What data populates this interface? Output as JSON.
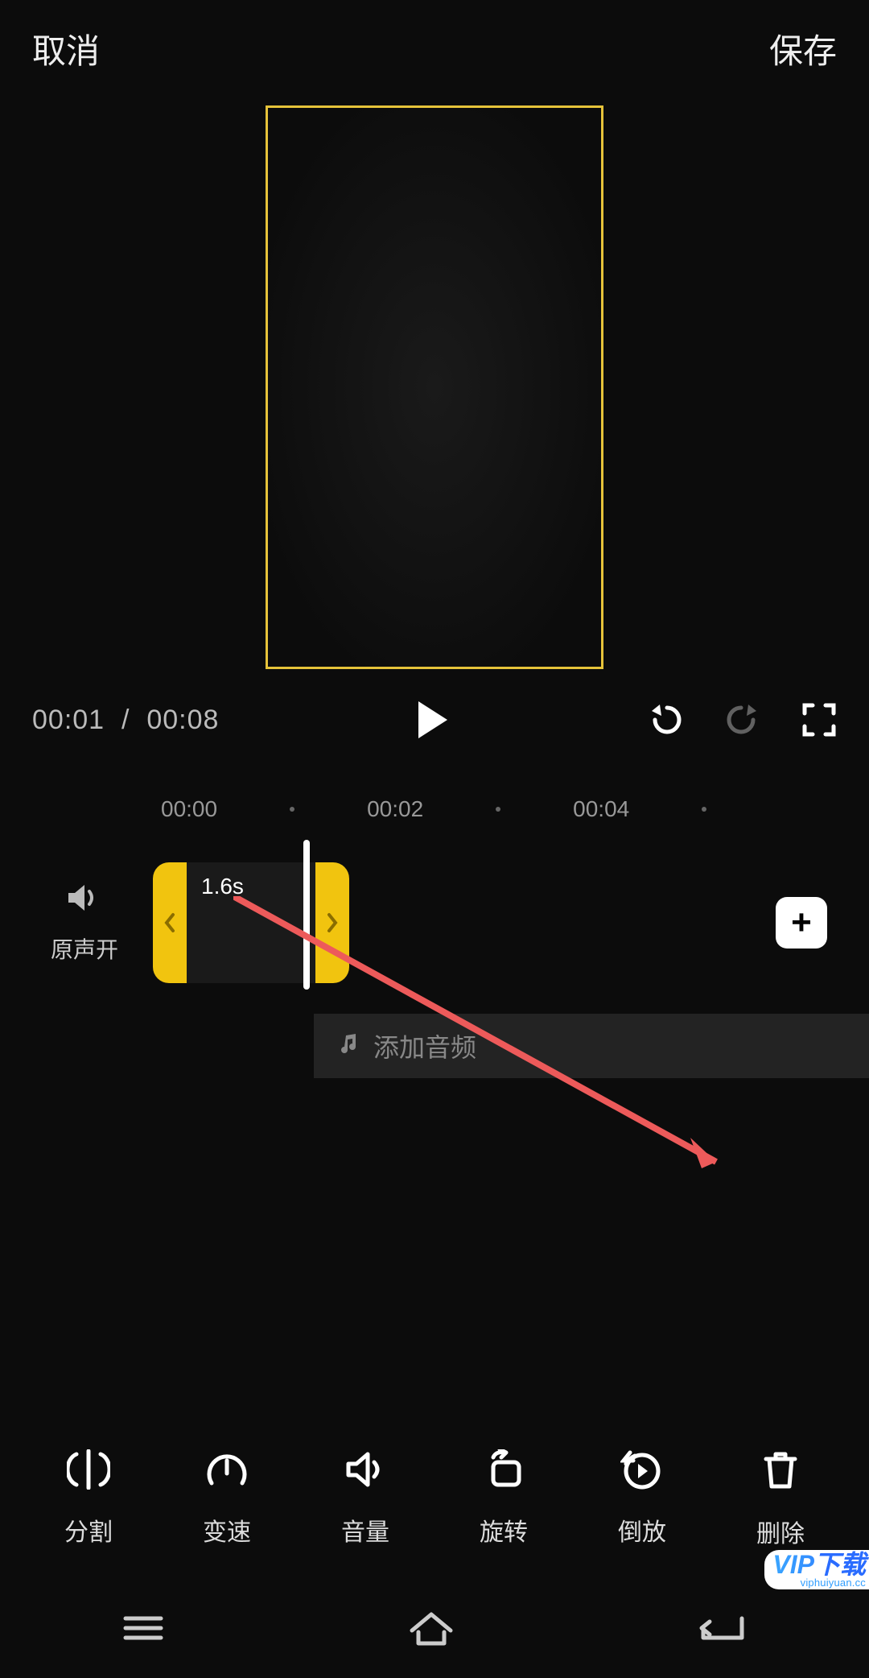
{
  "header": {
    "cancel": "取消",
    "save": "保存"
  },
  "time": {
    "current": "00:01",
    "sep": "/",
    "total": "00:08"
  },
  "ruler": {
    "t0": "00:00",
    "t1": "00:02",
    "t2": "00:04"
  },
  "sound": {
    "label": "原声开"
  },
  "clip": {
    "duration": "1.6s"
  },
  "audio": {
    "add": "添加音频"
  },
  "tools": {
    "split": "分割",
    "speed": "变速",
    "volume": "音量",
    "rotate": "旋转",
    "reverse": "倒放",
    "delete": "删除"
  },
  "watermark": {
    "brand1": "VIP",
    "brand1b": "下载",
    "url": "viphuiyuan.cc"
  },
  "icons": {
    "play": "play-icon",
    "undo": "undo-icon",
    "redo": "redo-icon",
    "fullscreen": "fullscreen-icon",
    "speaker": "speaker-icon",
    "music": "music-icon",
    "plus": "plus-icon",
    "split": "split-icon",
    "speed": "speedometer-icon",
    "volume": "volume-icon",
    "rotate": "rotate-icon",
    "reverse": "reverse-play-icon",
    "delete": "trash-icon",
    "menu": "menu-icon",
    "home": "home-icon",
    "back": "back-icon"
  },
  "colors": {
    "accent": "#f1c40f",
    "arrow": "#ed5a5a"
  }
}
